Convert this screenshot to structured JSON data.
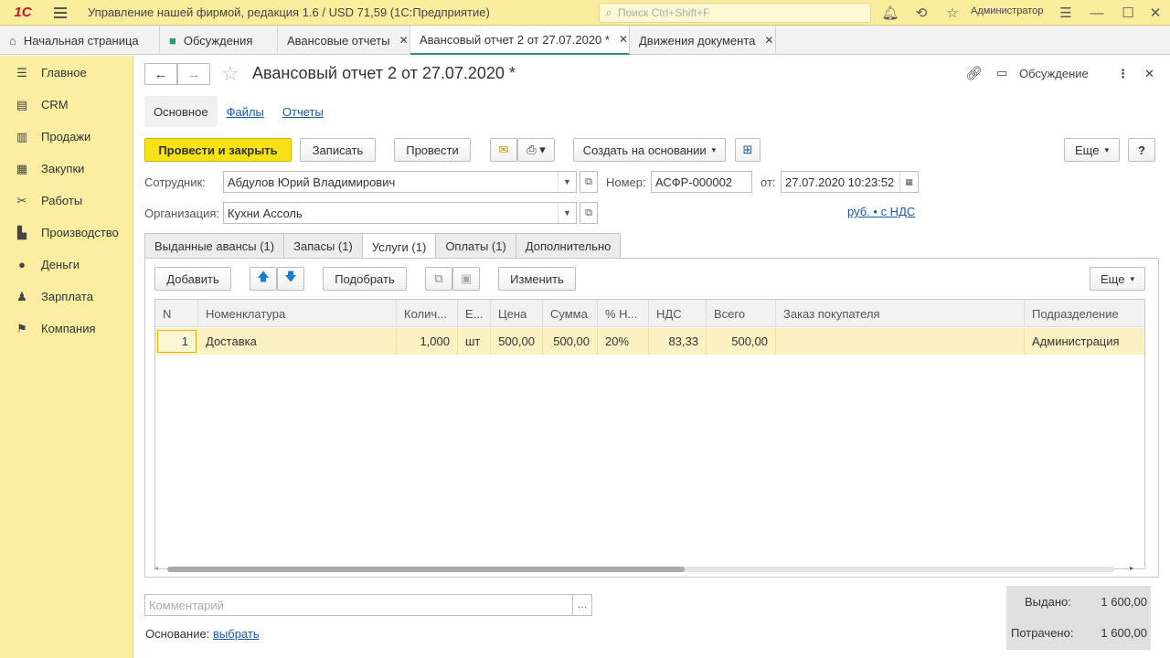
{
  "titlebar": {
    "logo": "1С",
    "title": "Управление нашей фирмой, редакция 1.6 / USD 71,59  (1С:Предприятие)",
    "search_placeholder": "Поиск Ctrl+Shift+F",
    "user": "Администратор"
  },
  "tabs": [
    {
      "label": "Начальная страница",
      "icon": "home-icon"
    },
    {
      "label": "Обсуждения",
      "icon": "chat-icon"
    },
    {
      "label": "Авансовые отчеты",
      "close": "✕"
    },
    {
      "label": "Авансовый отчет 2 от 27.07.2020 *",
      "close": "✕"
    },
    {
      "label": "Движения документа",
      "close": "✕"
    }
  ],
  "sidebar": {
    "items": [
      {
        "label": "Главное",
        "icon": "menu-icon"
      },
      {
        "label": "CRM",
        "icon": "crm-icon"
      },
      {
        "label": "Продажи",
        "icon": "sales-icon"
      },
      {
        "label": "Закупки",
        "icon": "purchases-icon"
      },
      {
        "label": "Работы",
        "icon": "works-icon"
      },
      {
        "label": "Производство",
        "icon": "production-icon"
      },
      {
        "label": "Деньги",
        "icon": "money-icon"
      },
      {
        "label": "Зарплата",
        "icon": "salary-icon"
      },
      {
        "label": "Компания",
        "icon": "company-icon"
      }
    ]
  },
  "document": {
    "title": "Авансовый отчет 2 от 27.07.2020 *",
    "discussion": "Обсуждение"
  },
  "subtabs": [
    "Основное",
    "Файлы",
    "Отчеты"
  ],
  "toolbar": {
    "post_close": "Провести и закрыть",
    "save": "Записать",
    "post": "Провести",
    "create_based": "Создать на основании",
    "more": "Еще",
    "help": "?"
  },
  "form": {
    "employee_label": "Сотрудник:",
    "employee_value": "Абдулов Юрий Владимирович",
    "number_label": "Номер:",
    "number_value": "АСФР-000002",
    "date_label": "от:",
    "date_value": "27.07.2020 10:23:52",
    "org_label": "Организация:",
    "org_value": "Кухни Ассоль",
    "currency_link": "руб. • с НДС"
  },
  "page_tabs": [
    "Выданные авансы (1)",
    "Запасы (1)",
    "Услуги (1)",
    "Оплаты (1)",
    "Дополнительно"
  ],
  "panel_toolbar": {
    "add": "Добавить",
    "pick": "Подобрать",
    "change": "Изменить",
    "more": "Еще"
  },
  "table": {
    "headers": [
      "N",
      "Номенклатура",
      "Колич...",
      "Е...",
      "Цена",
      "Сумма",
      "% Н...",
      "НДС",
      "Всего",
      "Заказ покупателя",
      "Подразделение"
    ],
    "rows": [
      [
        "1",
        "Доставка",
        "1,000",
        "шт",
        "500,00",
        "500,00",
        "20%",
        "83,33",
        "500,00",
        "",
        "Администрация"
      ]
    ]
  },
  "footer": {
    "comment_placeholder": "Комментарий",
    "basis_label": "Основание:",
    "basis_link": "выбрать",
    "issued_label": "Выдано:",
    "issued_value": "1 600,00",
    "spent_label": "Потрачено:",
    "spent_value": "1 600,00"
  }
}
